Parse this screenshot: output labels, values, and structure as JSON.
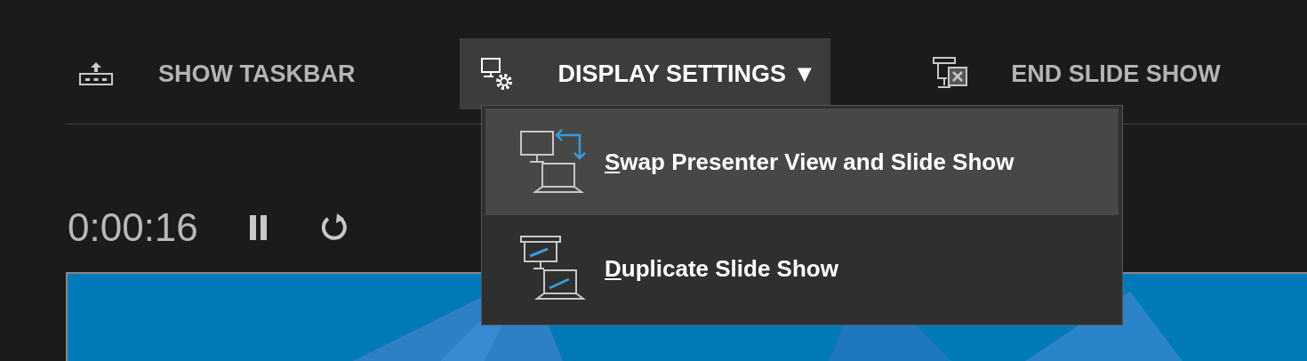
{
  "toolbar": {
    "buttons": [
      {
        "kind": "taskbar",
        "label": "SHOW TASKBAR",
        "expanded": false
      },
      {
        "kind": "display",
        "label": "DISPLAY SETTINGS",
        "caret": "▼",
        "expanded": true
      },
      {
        "kind": "end",
        "label": "END SLIDE SHOW",
        "expanded": false
      }
    ]
  },
  "display_menu": {
    "items": [
      {
        "kind": "swap",
        "label": "Swap Presenter View and Slide Show",
        "selected": true
      },
      {
        "kind": "duplicate",
        "label": "Duplicate Slide Show",
        "selected": false
      }
    ]
  },
  "timer": {
    "time": "0:00:16",
    "paused": false
  }
}
